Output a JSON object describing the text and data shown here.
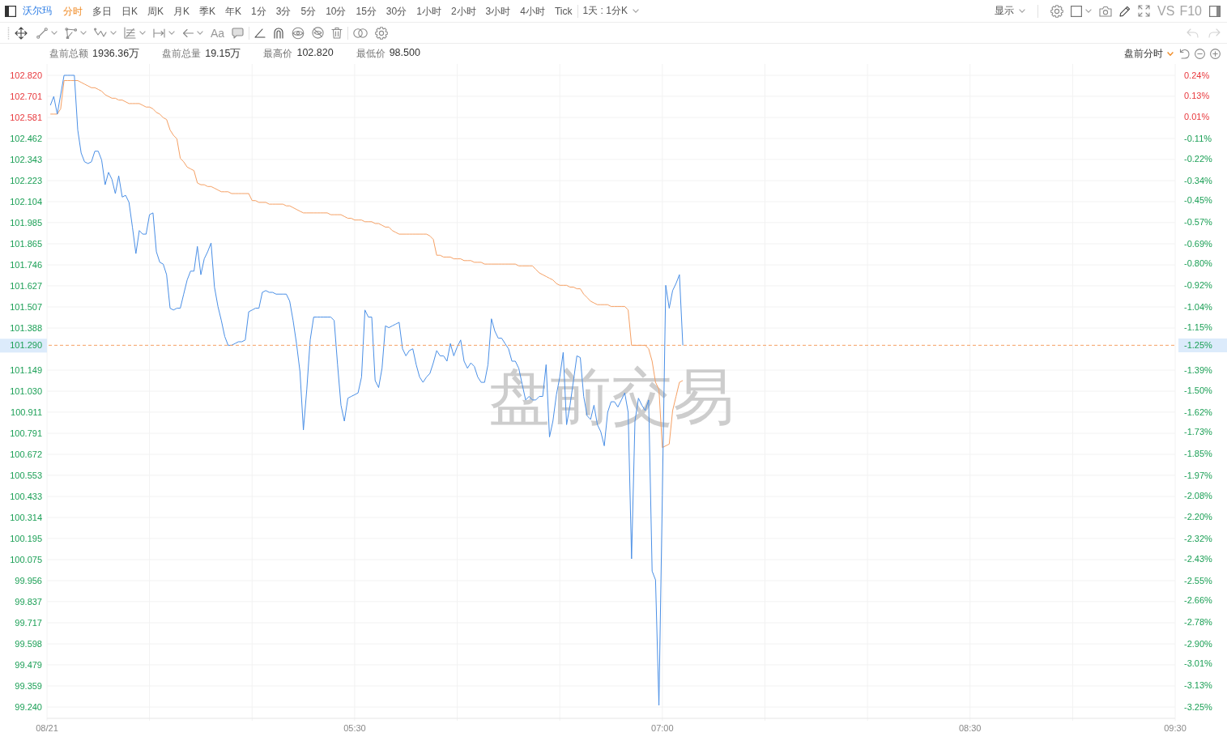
{
  "toolbar": {
    "symbol": "沃尔玛",
    "periods": [
      {
        "label": "分时",
        "selected": true
      },
      {
        "label": "多日",
        "selected": false
      },
      {
        "label": "日K",
        "selected": false
      },
      {
        "label": "周K",
        "selected": false
      },
      {
        "label": "月K",
        "selected": false
      },
      {
        "label": "季K",
        "selected": false
      },
      {
        "label": "年K",
        "selected": false
      },
      {
        "label": "1分",
        "selected": false
      },
      {
        "label": "3分",
        "selected": false
      },
      {
        "label": "5分",
        "selected": false
      },
      {
        "label": "10分",
        "selected": false
      },
      {
        "label": "15分",
        "selected": false
      },
      {
        "label": "30分",
        "selected": false
      },
      {
        "label": "1小时",
        "selected": false
      },
      {
        "label": "2小时",
        "selected": false
      },
      {
        "label": "3小时",
        "selected": false
      },
      {
        "label": "4小时",
        "selected": false
      },
      {
        "label": "Tick",
        "selected": false
      }
    ],
    "interval": "1天 : 1分K",
    "display": "显示",
    "vs": "VS",
    "f10": "F10"
  },
  "drawing_toolbar": {
    "text_tool": "Aa",
    "undo": {
      "disabled": true
    },
    "redo": {
      "disabled": true
    }
  },
  "stats": [
    {
      "label": "盘前总额",
      "value": "1936.36万"
    },
    {
      "label": "盘前总量",
      "value": "19.15万"
    },
    {
      "label": "最高价",
      "value": "102.820"
    },
    {
      "label": "最低价",
      "value": "98.500"
    }
  ],
  "session": "盘前分时",
  "chart": {
    "watermark": "盘前交易",
    "chart_data": {
      "type": "line",
      "grid": true,
      "categories": [
        "08/21",
        null,
        null,
        null,
        null,
        null,
        null,
        null,
        null,
        null,
        null,
        null,
        null,
        null,
        null,
        null,
        null,
        null,
        null,
        null,
        null,
        null,
        null,
        null,
        null,
        null,
        null,
        null,
        null,
        null,
        null,
        null,
        null,
        null,
        null,
        null,
        null,
        null,
        null,
        null,
        null,
        null,
        null,
        null,
        null,
        null,
        null,
        null,
        null,
        null,
        null,
        null,
        null,
        null,
        null,
        null,
        null,
        null,
        null,
        null,
        null,
        null,
        null,
        null,
        null,
        null,
        null,
        null,
        null,
        null,
        null,
        null,
        null,
        null,
        null,
        null,
        null,
        null,
        null,
        null,
        null,
        null,
        null,
        null,
        null,
        null,
        null,
        null,
        null,
        null,
        "05:30",
        null,
        null,
        null,
        null,
        null,
        null,
        null,
        null,
        null,
        null,
        null,
        null,
        null,
        null,
        null,
        null,
        null,
        null,
        null,
        null,
        null,
        null,
        null,
        null,
        null,
        null,
        null,
        null,
        null,
        null,
        null,
        null,
        null,
        null,
        null,
        null,
        null,
        null,
        null,
        null,
        null,
        null,
        null,
        null,
        null,
        null,
        null,
        null,
        null,
        null,
        null,
        null,
        null,
        null,
        null,
        null,
        null,
        null,
        null,
        null,
        null,
        null,
        null,
        null,
        null,
        null,
        null,
        null,
        null,
        null,
        null,
        null,
        null,
        null,
        null,
        null,
        null,
        null,
        null,
        null,
        null,
        null,
        null,
        null,
        null,
        null,
        null,
        null,
        null,
        "07:00",
        null,
        null,
        null,
        null,
        null,
        null,
        null,
        null,
        null,
        null,
        null,
        null,
        null,
        null,
        null,
        null,
        null,
        null,
        null,
        null,
        null,
        null,
        null,
        null,
        null,
        null,
        null,
        null,
        null,
        null,
        null,
        null,
        null,
        null,
        null,
        null,
        null,
        null,
        null,
        null,
        null,
        null,
        null,
        null,
        null,
        null,
        null,
        null,
        null,
        null,
        null,
        null,
        null,
        null,
        null,
        null,
        null,
        null,
        null,
        null,
        null,
        null,
        null,
        null,
        null,
        null,
        null,
        null,
        null,
        null,
        null,
        null,
        null,
        null,
        null,
        null,
        null,
        null,
        null,
        null,
        null,
        null,
        null,
        null,
        null,
        null,
        null,
        null,
        null,
        "08:30",
        null,
        null,
        null,
        null,
        null,
        null,
        null,
        null,
        null,
        null,
        null,
        null,
        null,
        null,
        null,
        null,
        null,
        null,
        null,
        null,
        null,
        null,
        null,
        null,
        null,
        null,
        null,
        null,
        null,
        null,
        null,
        null,
        null,
        null,
        null,
        null,
        null,
        null,
        null,
        null,
        null,
        null,
        null,
        null,
        null,
        null,
        null,
        null,
        null,
        null,
        null,
        null,
        null,
        null,
        null,
        null,
        null,
        null,
        null,
        "09:30"
      ],
      "ylim": [
        99.24,
        102.82
      ],
      "y2lim": [
        -3.25,
        0.24
      ],
      "yticks": [
        {
          "value": 102.82,
          "label": "102.820"
        },
        {
          "value": 102.701,
          "label": "102.701"
        },
        {
          "value": 102.581,
          "label": "102.581"
        },
        {
          "value": 102.462,
          "label": "102.462"
        },
        {
          "value": 102.343,
          "label": "102.343"
        },
        {
          "value": 102.223,
          "label": "102.223"
        },
        {
          "value": 102.104,
          "label": "102.104"
        },
        {
          "value": 101.985,
          "label": "101.985"
        },
        {
          "value": 101.865,
          "label": "101.865"
        },
        {
          "value": 101.746,
          "label": "101.746"
        },
        {
          "value": 101.627,
          "label": "101.627"
        },
        {
          "value": 101.507,
          "label": "101.507"
        },
        {
          "value": 101.388,
          "label": "101.388"
        },
        {
          "value": 101.149,
          "label": "101.149"
        },
        {
          "value": 101.03,
          "label": "101.030"
        },
        {
          "value": 100.911,
          "label": "100.911"
        },
        {
          "value": 100.791,
          "label": "100.791"
        },
        {
          "value": 100.672,
          "label": "100.672"
        },
        {
          "value": 100.553,
          "label": "100.553"
        },
        {
          "value": 100.433,
          "label": "100.433"
        },
        {
          "value": 100.314,
          "label": "100.314"
        },
        {
          "value": 100.195,
          "label": "100.195"
        },
        {
          "value": 100.075,
          "label": "100.075"
        },
        {
          "value": 99.956,
          "label": "99.956"
        },
        {
          "value": 99.837,
          "label": "99.837"
        },
        {
          "value": 99.717,
          "label": "99.717"
        },
        {
          "value": 99.598,
          "label": "99.598"
        },
        {
          "value": 99.479,
          "label": "99.479"
        },
        {
          "value": 99.359,
          "label": "99.359"
        },
        {
          "value": 99.24,
          "label": "99.240"
        }
      ],
      "y2ticks": [
        {
          "value": 0.24,
          "label": "0.24%"
        },
        {
          "value": 0.13,
          "label": "0.13%"
        },
        {
          "value": 0.01,
          "label": "0.01%"
        },
        {
          "value": -0.11,
          "label": "-0.11%"
        },
        {
          "value": -0.22,
          "label": "-0.22%"
        },
        {
          "value": -0.34,
          "label": "-0.34%"
        },
        {
          "value": -0.45,
          "label": "-0.45%"
        },
        {
          "value": -0.57,
          "label": "-0.57%"
        },
        {
          "value": -0.69,
          "label": "-0.69%"
        },
        {
          "value": -0.8,
          "label": "-0.80%"
        },
        {
          "value": -0.92,
          "label": "-0.92%"
        },
        {
          "value": -1.04,
          "label": "-1.04%"
        },
        {
          "value": -1.15,
          "label": "-1.15%"
        },
        {
          "value": -1.25,
          "label": "-1.25%"
        },
        {
          "value": -1.39,
          "label": "-1.39%"
        },
        {
          "value": -1.5,
          "label": "-1.50%"
        },
        {
          "value": -1.62,
          "label": "-1.62%"
        },
        {
          "value": -1.73,
          "label": "-1.73%"
        },
        {
          "value": -1.85,
          "label": "-1.85%"
        },
        {
          "value": -1.97,
          "label": "-1.97%"
        },
        {
          "value": -2.08,
          "label": "-2.08%"
        },
        {
          "value": -2.2,
          "label": "-2.20%"
        },
        {
          "value": -2.32,
          "label": "-2.32%"
        },
        {
          "value": -2.43,
          "label": "-2.43%"
        },
        {
          "value": -2.55,
          "label": "-2.55%"
        },
        {
          "value": -2.66,
          "label": "-2.66%"
        },
        {
          "value": -2.78,
          "label": "-2.78%"
        },
        {
          "value": -2.9,
          "label": "-2.90%"
        },
        {
          "value": -3.01,
          "label": "-3.01%"
        },
        {
          "value": -3.13,
          "label": "-3.13%"
        },
        {
          "value": -3.25,
          "label": "-3.25%"
        }
      ],
      "series": [
        {
          "color": "#f5a064",
          "values": [
            null,
            102.6,
            102.6,
            102.6,
            102.63,
            102.79,
            102.79,
            102.79,
            102.79,
            102.79,
            102.78,
            102.77,
            102.76,
            102.75,
            102.75,
            102.74,
            102.73,
            102.71,
            102.7,
            102.69,
            102.69,
            102.68,
            102.68,
            102.67,
            102.66,
            102.66,
            102.66,
            102.66,
            102.65,
            102.64,
            102.64,
            102.63,
            102.61,
            102.6,
            102.58,
            102.57,
            102.51,
            102.48,
            102.46,
            102.35,
            102.33,
            102.3,
            102.29,
            102.28,
            102.21,
            102.2,
            102.2,
            102.19,
            102.19,
            102.18,
            102.17,
            102.16,
            102.16,
            102.16,
            102.15,
            102.15,
            102.15,
            102.15,
            102.15,
            102.15,
            102.11,
            102.11,
            102.1,
            102.1,
            102.1,
            102.09,
            102.09,
            102.09,
            102.09,
            102.09,
            102.08,
            102.08,
            102.07,
            102.06,
            102.05,
            102.04,
            102.04,
            102.04,
            102.04,
            102.04,
            102.04,
            102.04,
            102.04,
            102.03,
            102.03,
            102.03,
            102.03,
            102.02,
            102.01,
            102.01,
            102.0,
            102.0,
            102.0,
            101.99,
            101.99,
            101.99,
            101.98,
            101.98,
            101.97,
            101.96,
            101.96,
            101.94,
            101.93,
            101.92,
            101.92,
            101.92,
            101.92,
            101.92,
            101.92,
            101.92,
            101.92,
            101.92,
            101.91,
            101.89,
            101.8,
            101.8,
            101.79,
            101.79,
            101.79,
            101.78,
            101.78,
            101.78,
            101.77,
            101.77,
            101.77,
            101.76,
            101.76,
            101.76,
            101.75,
            101.75,
            101.75,
            101.75,
            101.75,
            101.75,
            101.75,
            101.75,
            101.75,
            101.75,
            101.74,
            101.74,
            101.74,
            101.74,
            101.74,
            101.72,
            101.7,
            101.69,
            101.68,
            101.67,
            101.66,
            101.64,
            101.63,
            101.63,
            101.63,
            101.62,
            101.62,
            101.61,
            101.61,
            101.58,
            101.56,
            101.54,
            101.53,
            101.52,
            101.52,
            101.52,
            101.52,
            101.51,
            101.51,
            101.51,
            101.51,
            101.51,
            101.49,
            101.29,
            101.29,
            101.29,
            101.29,
            101.29,
            101.27,
            101.2,
            101.08,
            101.04,
            100.71,
            100.72,
            100.73,
            100.92,
            101.0,
            101.08,
            101.09,
            null,
            null,
            null,
            null,
            null,
            null,
            null,
            null,
            null,
            null,
            null,
            null,
            null,
            null,
            null,
            null,
            null,
            null,
            null,
            null,
            null,
            null,
            null,
            null,
            null,
            null,
            null,
            null,
            null,
            null,
            null,
            null,
            null,
            null,
            null,
            null,
            null,
            null,
            null,
            null,
            null,
            null,
            null,
            null,
            null,
            null,
            null,
            null,
            null,
            null,
            null,
            null,
            null,
            null,
            null,
            null,
            null,
            null,
            null,
            null,
            null,
            null,
            null,
            null,
            null,
            null,
            null,
            null,
            null,
            null,
            null,
            null,
            null,
            null,
            null,
            null,
            null,
            null,
            null,
            null,
            null,
            null,
            null,
            null,
            null,
            null,
            null,
            null,
            null,
            null,
            null,
            null,
            null,
            null,
            null,
            null,
            null,
            null,
            null,
            null,
            null,
            null,
            null,
            null,
            null,
            null,
            null,
            null,
            null,
            null,
            null,
            null,
            null,
            null,
            null,
            null,
            null,
            null,
            null,
            null,
            null,
            null,
            null,
            null,
            null,
            null,
            null,
            null,
            null,
            null,
            null,
            null,
            null,
            null,
            null,
            null,
            null,
            null,
            null,
            null,
            null,
            null,
            null,
            null
          ]
        },
        {
          "color": "#4a8fe6",
          "values": [
            null,
            102.65,
            102.7,
            102.6,
            102.71,
            102.82,
            102.82,
            102.82,
            102.82,
            102.51,
            102.38,
            102.33,
            102.32,
            102.33,
            102.39,
            102.39,
            102.34,
            102.2,
            102.27,
            102.23,
            102.15,
            102.25,
            102.13,
            102.14,
            102.1,
            101.96,
            101.81,
            101.94,
            101.92,
            101.92,
            102.03,
            102.04,
            101.82,
            101.76,
            101.75,
            101.69,
            101.5,
            101.49,
            101.5,
            101.5,
            101.58,
            101.66,
            101.71,
            101.71,
            101.85,
            101.69,
            101.78,
            101.82,
            101.87,
            101.62,
            101.51,
            101.43,
            101.34,
            101.29,
            101.29,
            101.3,
            101.31,
            101.31,
            101.32,
            101.48,
            101.49,
            101.5,
            101.5,
            101.59,
            101.6,
            101.59,
            101.59,
            101.58,
            101.58,
            101.58,
            101.58,
            101.54,
            101.43,
            101.3,
            101.14,
            100.81,
            101.04,
            101.32,
            101.45,
            101.45,
            101.45,
            101.45,
            101.45,
            101.45,
            101.43,
            101.18,
            100.95,
            100.86,
            100.99,
            101.0,
            101.01,
            101.02,
            101.11,
            101.49,
            101.45,
            101.45,
            101.09,
            101.05,
            101.16,
            101.4,
            101.39,
            101.4,
            101.41,
            101.42,
            101.27,
            101.23,
            101.26,
            101.27,
            101.18,
            101.11,
            101.08,
            101.11,
            101.13,
            101.19,
            101.26,
            101.23,
            101.23,
            101.2,
            101.3,
            101.23,
            101.28,
            101.32,
            101.2,
            101.16,
            101.19,
            101.17,
            101.11,
            101.08,
            101.08,
            101.18,
            101.44,
            101.37,
            101.33,
            101.33,
            101.3,
            101.27,
            101.2,
            101.2,
            101.16,
            101.07,
            100.98,
            101.0,
            100.98,
            100.98,
            101.0,
            101.0,
            101.18,
            100.77,
            100.86,
            101.01,
            101.11,
            101.25,
            100.84,
            100.95,
            101.09,
            101.23,
            101.22,
            101.0,
            100.89,
            100.87,
            100.95,
            100.84,
            100.8,
            100.72,
            100.91,
            100.97,
            100.97,
            100.94,
            100.98,
            101.02,
            100.91,
            100.08,
            100.86,
            100.99,
            100.95,
            100.92,
            100.98,
            100.01,
            99.96,
            99.25,
            100.44,
            101.63,
            101.5,
            101.6,
            101.64,
            101.69,
            101.29,
            null,
            null,
            null,
            null,
            null,
            null,
            null,
            null,
            null,
            null,
            null,
            null,
            null,
            null,
            null,
            null,
            null,
            null,
            null,
            null,
            null,
            null,
            null,
            null,
            null,
            null,
            null,
            null,
            null,
            null,
            null,
            null,
            null,
            null,
            null,
            null,
            null,
            null,
            null,
            null,
            null,
            null,
            null,
            null,
            null,
            null,
            null,
            null,
            null,
            null,
            null,
            null,
            null,
            null,
            null,
            null,
            null,
            null,
            null,
            null,
            null,
            null,
            null,
            null,
            null,
            null,
            null,
            null,
            null,
            null,
            null,
            null,
            null,
            null,
            null,
            null,
            null,
            null,
            null,
            null,
            null,
            null,
            null,
            null,
            null,
            null,
            null,
            null,
            null,
            null,
            null,
            null,
            null,
            null,
            null,
            null,
            null,
            null,
            null,
            null,
            null,
            null,
            null,
            null,
            null,
            null,
            null,
            null,
            null,
            null,
            null,
            null,
            null,
            null,
            null,
            null,
            null,
            null,
            null,
            null,
            null,
            null,
            null,
            null,
            null,
            null,
            null,
            null,
            null,
            null,
            null,
            null,
            null,
            null,
            null,
            null,
            null,
            null,
            null,
            null,
            null,
            null,
            null,
            null
          ]
        }
      ],
      "ref_lines": [
        {
          "axis": "y",
          "value": 101.29,
          "label": "101.290"
        }
      ]
    }
  }
}
